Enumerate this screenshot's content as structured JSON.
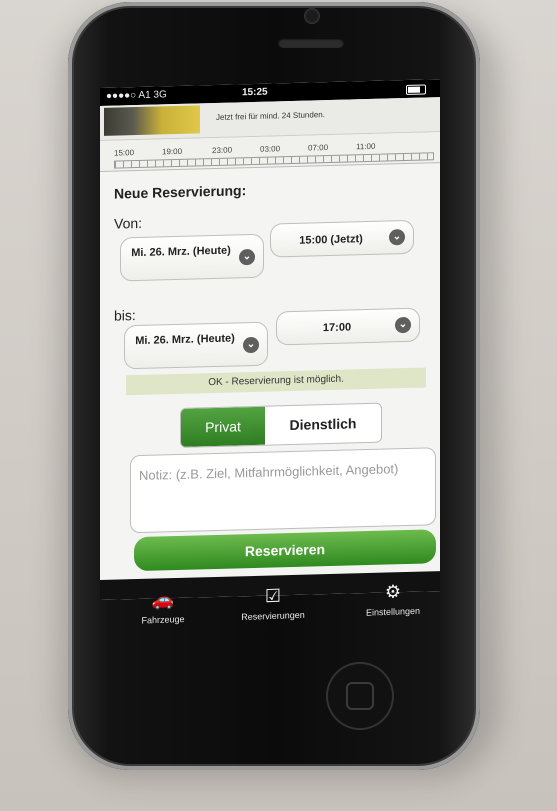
{
  "statusbar": {
    "carrier": "●●●●○ A1  3G",
    "time": "15:25"
  },
  "banner": {
    "text": "Jetzt frei für mind. 24 Stunden."
  },
  "timeline": {
    "ticks": [
      "15:00",
      "19:00",
      "23:00",
      "03:00",
      "07:00",
      "11:00"
    ]
  },
  "form": {
    "title": "Neue Reservierung:",
    "von_label": "Von:",
    "von_date": "Mi. 26. Mrz. (Heute)",
    "von_time": "15:00 (Jetzt)",
    "bis_label": "bis:",
    "bis_date": "Mi. 26. Mrz. (Heute)",
    "bis_time": "17:00",
    "status": "OK - Reservierung ist möglich.",
    "segment": {
      "privat": "Privat",
      "dienstlich": "Dienstlich",
      "selected": "Privat"
    },
    "note_placeholder": "Notiz: (z.B. Ziel, Mitfahrmöglichkeit, Angebot)",
    "reserve_label": "Reservieren"
  },
  "tabs": [
    {
      "label": "Fahrzeuge",
      "icon": "car-icon"
    },
    {
      "label": "Reservierungen",
      "icon": "calendar-check-icon"
    },
    {
      "label": "Einstellungen",
      "icon": "gears-icon"
    }
  ],
  "colors": {
    "accent_green": "#2f8a20",
    "status_bg": "#dfe6c8"
  }
}
